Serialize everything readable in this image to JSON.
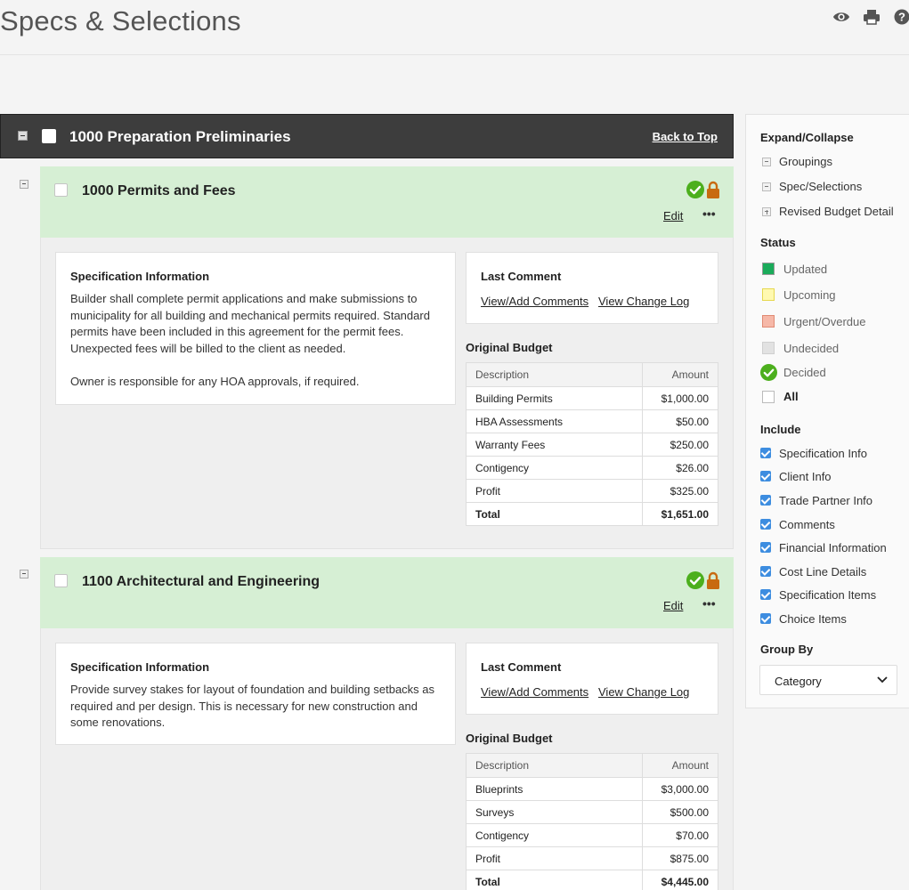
{
  "page": {
    "title": "Specs & Selections"
  },
  "header_icons": [
    "eye-icon",
    "printer-icon",
    "help-icon"
  ],
  "group": {
    "title": "1000 Preparation Preliminaries",
    "back_to_top": "Back to Top"
  },
  "items": [
    {
      "title": "1000 Permits and Fees",
      "edit_label": "Edit",
      "more_label": "•••",
      "spec_heading": "Specification Information",
      "spec_text_1": "Builder shall complete permit applications and make submissions to municipality for all building and mechanical permits required. Standard permits have been included in this agreement for the permit fees. Unexpected fees will be billed to the client as needed.",
      "spec_text_2": "Owner is responsible for any HOA approvals, if required.",
      "comment_heading": "Last Comment",
      "view_add_comments": "View/Add Comments",
      "view_change_log": "View Change Log",
      "budget_heading": "Original Budget",
      "col_description": "Description",
      "col_amount": "Amount",
      "rows": [
        {
          "description": "Building Permits",
          "amount": "$1,000.00"
        },
        {
          "description": "HBA Assessments",
          "amount": "$50.00"
        },
        {
          "description": "Warranty Fees",
          "amount": "$250.00"
        },
        {
          "description": "Contigency",
          "amount": "$26.00"
        },
        {
          "description": "Profit",
          "amount": "$325.00"
        }
      ],
      "total_label": "Total",
      "total_amount": "$1,651.00"
    },
    {
      "title": "1100 Architectural and Engineering",
      "edit_label": "Edit",
      "more_label": "•••",
      "spec_heading": "Specification Information",
      "spec_text_1": "Provide survey stakes for layout of foundation and building setbacks as required and per design. This is necessary for new construction and some renovations.",
      "comment_heading": "Last Comment",
      "view_add_comments": "View/Add Comments",
      "view_change_log": "View Change Log",
      "budget_heading": "Original Budget",
      "col_description": "Description",
      "col_amount": "Amount",
      "rows": [
        {
          "description": "Blueprints",
          "amount": "$3,000.00"
        },
        {
          "description": "Surveys",
          "amount": "$500.00"
        },
        {
          "description": "Contigency",
          "amount": "$70.00"
        },
        {
          "description": "Profit",
          "amount": "$875.00"
        }
      ],
      "total_label": "Total",
      "total_amount": "$4,445.00"
    }
  ],
  "sidebar": {
    "expand_heading": "Expand/Collapse",
    "expand_items": [
      "Groupings",
      "Spec/Selections",
      "Revised Budget Detail"
    ],
    "status_heading": "Status",
    "status_items": [
      {
        "label": "Updated",
        "color": "#1aab5a"
      },
      {
        "label": "Upcoming",
        "color": "#fff9b0"
      },
      {
        "label": "Urgent/Overdue",
        "color": "#f6b8a8"
      },
      {
        "label": "Undecided",
        "color": "#e2e2e2"
      },
      {
        "label": "Decided",
        "color": "#4caf1d"
      },
      {
        "label": "All",
        "color": "#ffffff"
      }
    ],
    "include_heading": "Include",
    "include_items": [
      "Specification Info",
      "Client Info",
      "Trade Partner Info",
      "Comments",
      "Financial Information",
      "Cost Line Details",
      "Specification Items",
      "Choice Items"
    ],
    "group_by_heading": "Group By",
    "group_by_value": "Category"
  }
}
